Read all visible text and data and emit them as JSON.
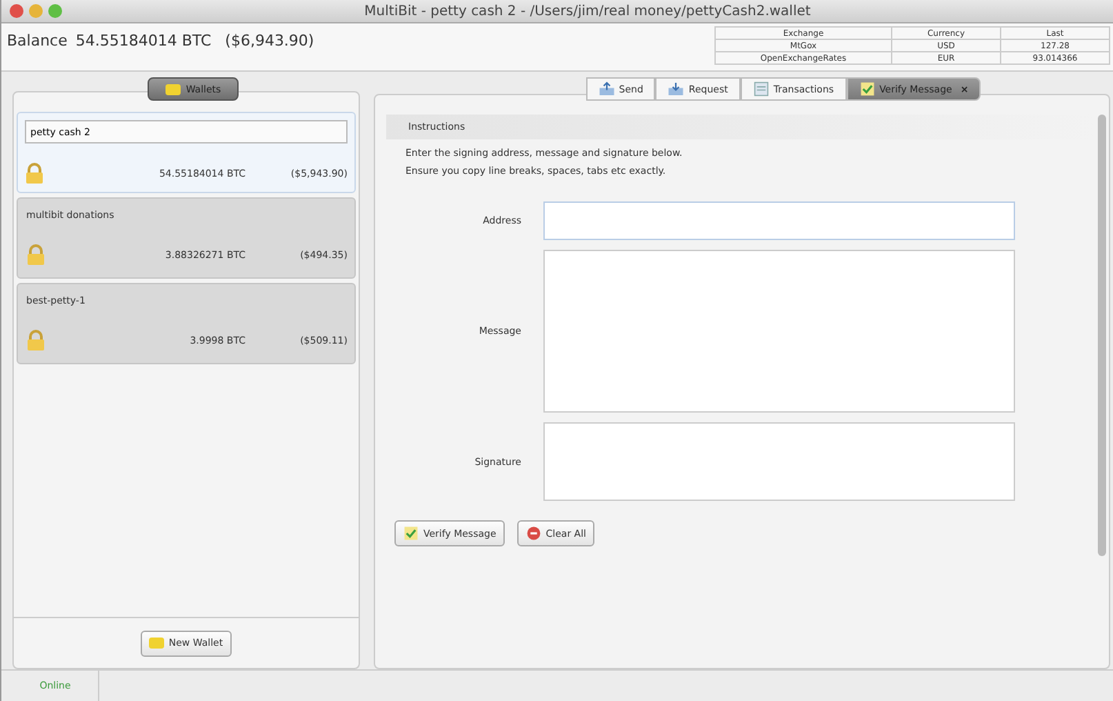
{
  "window": {
    "title": "MultiBit - petty cash 2 - /Users/jim/real money/pettyCash2.wallet"
  },
  "balance": {
    "label": "Balance",
    "btc": "54.55184014 BTC",
    "fiat": "($6,943.90)"
  },
  "exchange_table": {
    "columns": [
      "Exchange",
      "Currency",
      "Last"
    ],
    "rows": [
      {
        "cells": [
          "MtGox",
          "USD",
          "127.28"
        ]
      },
      {
        "cells": [
          "OpenExchangeRates",
          "EUR",
          "93.014366"
        ]
      }
    ]
  },
  "wallets_tab": {
    "label": "Wallets"
  },
  "wallets": [
    {
      "name": "petty cash 2",
      "btc": "54.55184014 BTC",
      "fiat": "($5,943.90)",
      "selected": true
    },
    {
      "name": "multibit donations",
      "btc": "3.88326271 BTC",
      "fiat": "($494.35)",
      "selected": false
    },
    {
      "name": "best-petty-1",
      "btc": "3.9998 BTC",
      "fiat": "($509.11)",
      "selected": false
    }
  ],
  "new_wallet_button": "New Wallet",
  "tabs": [
    {
      "label": "Send",
      "kind": "send",
      "selected": false
    },
    {
      "label": "Request",
      "kind": "request",
      "selected": false
    },
    {
      "label": "Transactions",
      "kind": "transactions",
      "selected": false
    },
    {
      "label": "Verify Message",
      "kind": "verify",
      "selected": true,
      "close": "×"
    }
  ],
  "instructions": {
    "title": "Instructions",
    "lines": [
      "Enter the signing address, message and signature below.",
      "Ensure you copy line breaks, spaces, tabs etc exactly."
    ]
  },
  "fields": [
    {
      "label": "Address",
      "kind": "line"
    },
    {
      "label": "Message",
      "kind": "area"
    },
    {
      "label": "Signature",
      "kind": "box"
    }
  ],
  "buttons": [
    {
      "label": "Verify Message",
      "kind": "verify"
    },
    {
      "label": "Clear All",
      "kind": "clear"
    }
  ],
  "status_bar": {
    "status": "Online"
  }
}
